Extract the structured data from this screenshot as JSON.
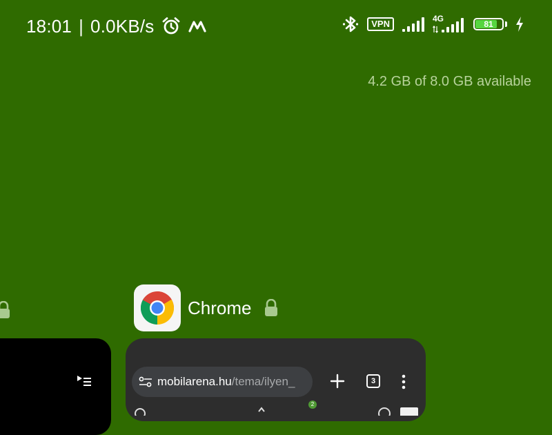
{
  "status_bar": {
    "time": "18:01",
    "separator": "|",
    "network_speed": "0.0KB/s",
    "icons": [
      "alarm-icon",
      "m-app-icon",
      "bluetooth-icon",
      "vpn-icon",
      "signal-icon",
      "lte-signal-icon",
      "battery-icon",
      "charging-icon"
    ],
    "vpn_label": "VPN",
    "network_type": "4G",
    "battery_level": "81",
    "battery_fraction": 0.81,
    "battery_color": "#56d640"
  },
  "memory": {
    "text": "4.2 GB of 8.0 GB available"
  },
  "recent_apps": {
    "chrome": {
      "name": "Chrome",
      "url_host": "mobilarena.hu",
      "url_path": "/tema/ilyen_",
      "tab_count": "3",
      "badge_count": "2"
    }
  },
  "colors": {
    "background": "#2f6b00",
    "chrome_toolbar": "#2d2d2d",
    "omnibox": "#3d3f42",
    "memory_text": "#b8d39c"
  }
}
